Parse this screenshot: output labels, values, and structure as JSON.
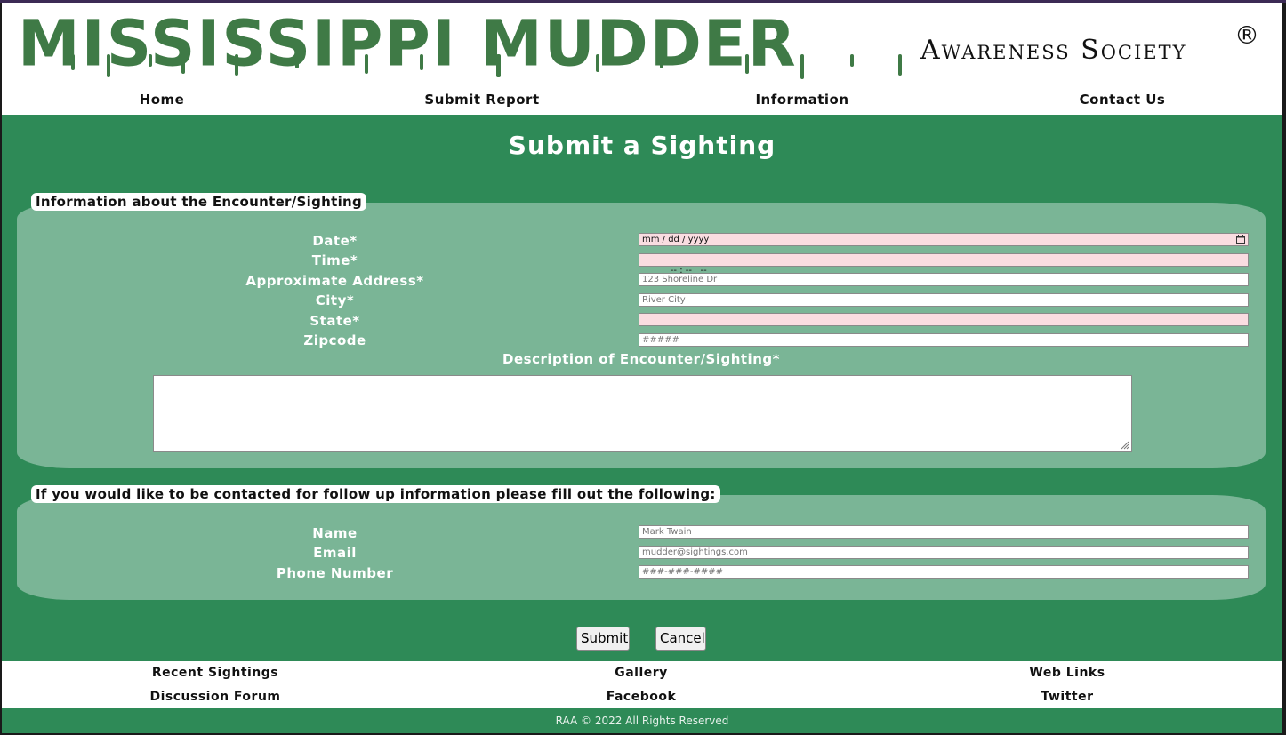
{
  "header": {
    "logo_main": "MISSISSIPPI MUDDER",
    "logo_sub": "Awareness Society",
    "logo_reg": "®"
  },
  "nav": {
    "items": [
      "Home",
      "Submit Report",
      "Information",
      "Contact Us"
    ]
  },
  "main": {
    "title": "Submit a Sighting",
    "encounter": {
      "legend": "Information about the Encounter/Sighting",
      "date_label": "Date*",
      "date_placeholder": "mm / dd / yyyy",
      "time_label": "Time*",
      "time_placeholder": "-- : --   --",
      "address_label": "Approximate Address*",
      "address_placeholder": "123 Shoreline Dr",
      "city_label": "City*",
      "city_placeholder": "River City",
      "state_label": "State*",
      "state_value": "",
      "zip_label": "Zipcode",
      "zip_placeholder": "#####",
      "description_label": "Description of Encounter/Sighting*"
    },
    "contact": {
      "legend": "If you would like to be contacted for follow up information please fill out the following:",
      "name_label": "Name",
      "name_placeholder": "Mark Twain",
      "email_label": "Email",
      "email_placeholder": "mudder@sightings.com",
      "phone_label": "Phone Number",
      "phone_placeholder": "###-###-####"
    },
    "buttons": {
      "submit": "Submit",
      "cancel": "Cancel"
    }
  },
  "footer": {
    "links": [
      "Recent Sightings",
      "Gallery",
      "Web Links",
      "Discussion Forum",
      "Facebook",
      "Twitter"
    ],
    "copyright": "RAA © 2022 All Rights Reserved"
  },
  "colors": {
    "brand_green": "#2e8a57",
    "panel_green": "#7ab596",
    "logo_green": "#3f7a46",
    "required_field": "#fadde1"
  },
  "icons": [
    "calendar-icon",
    "resize-grip-icon"
  ]
}
